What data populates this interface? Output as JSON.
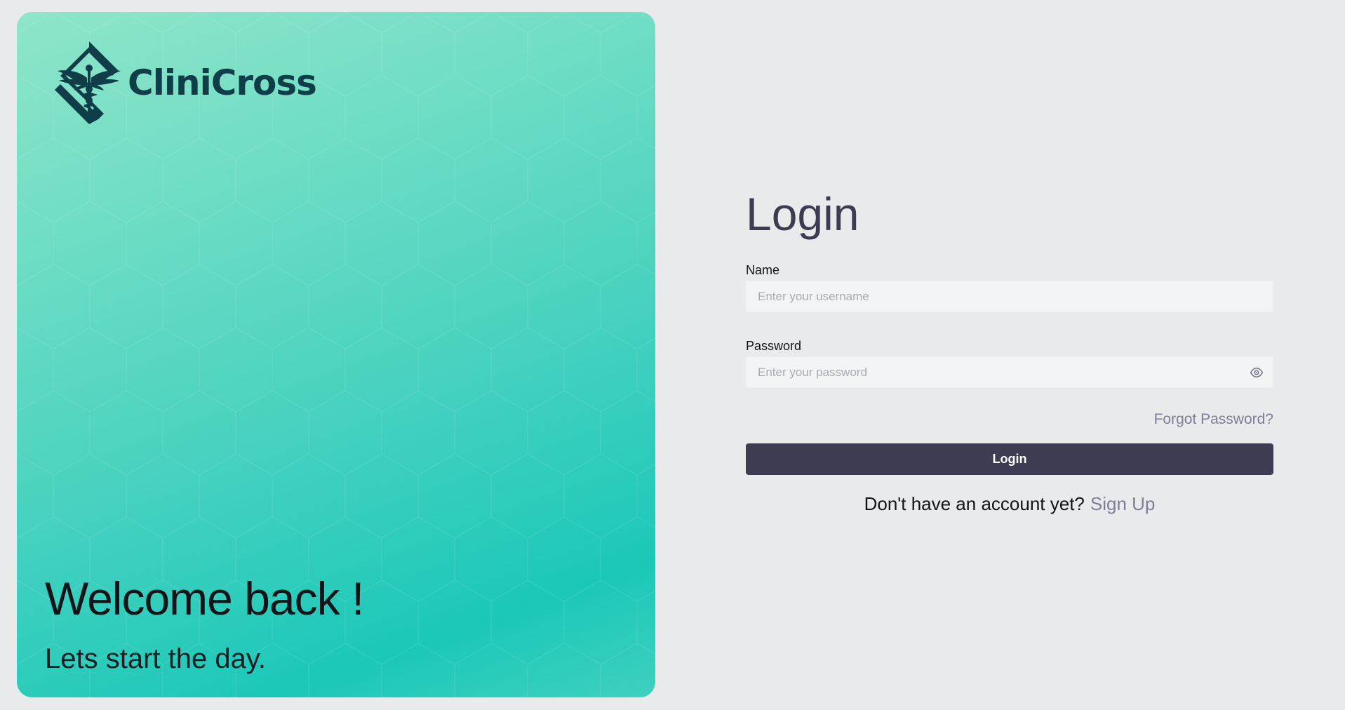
{
  "brand": {
    "name": "CliniCross",
    "logo_icon": "caduceus-diamond-icon"
  },
  "hero": {
    "welcome_title": "Welcome back !",
    "welcome_subtitle": "Lets start the day."
  },
  "login": {
    "title": "Login",
    "name_label": "Name",
    "name_placeholder": "Enter your username",
    "password_label": "Password",
    "password_placeholder": "Enter your password",
    "password_toggle_icon": "eye-icon",
    "forgot_password": "Forgot Password?",
    "submit_label": "Login",
    "no_account_text": "Don't have an account yet?",
    "signup_link": "Sign Up"
  },
  "colors": {
    "background": "#e9eaec",
    "primary_dark": "#3e3c52",
    "link": "#7d7f99",
    "brand_text": "#0f3d48",
    "hero_gradient_top": "#8fe5c9",
    "hero_gradient_bottom": "#1bc8b8"
  }
}
